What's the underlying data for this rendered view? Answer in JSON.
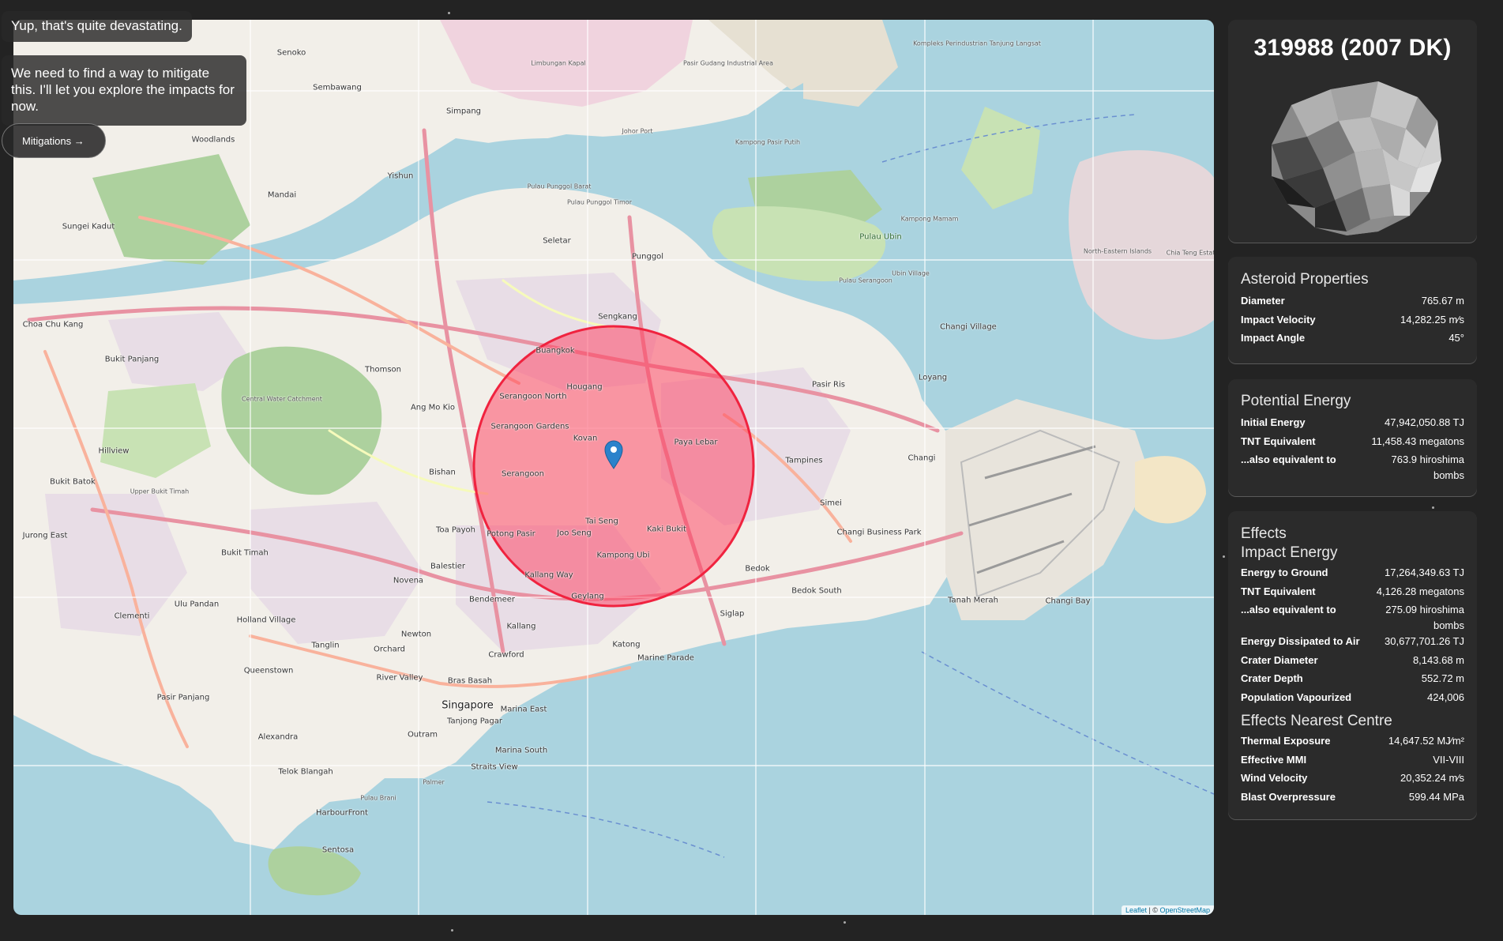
{
  "overlay": {
    "message1": "Yup, that's quite devastating.",
    "message2": "We need to find a way to mitigate this. I'll let you explore the impacts for now.",
    "mitigations_button": "Mitigations →"
  },
  "asteroid": {
    "name": "319988 (2007 DK)"
  },
  "properties": {
    "title": "Asteroid Properties",
    "rows": [
      {
        "label": "Diameter",
        "value": "765.67 m"
      },
      {
        "label": "Impact Velocity",
        "value": "14,282.25 m⁄s"
      },
      {
        "label": "Impact Angle",
        "value": "45°"
      }
    ]
  },
  "energy": {
    "title": "Potential Energy",
    "rows": [
      {
        "label": "Initial Energy",
        "value": "47,942,050.88 TJ"
      },
      {
        "label": "TNT Equivalent",
        "value": "11,458.43 megatons"
      },
      {
        "label": "...also equivalent to",
        "value": "763.9 hiroshima bombs"
      }
    ]
  },
  "effects": {
    "title": "Effects",
    "impact_title": "Impact Energy",
    "impact_rows": [
      {
        "label": "Energy to Ground",
        "value": "17,264,349.63 TJ"
      },
      {
        "label": "TNT Equivalent",
        "value": "4,126.28 megatons"
      },
      {
        "label": "...also equivalent to",
        "value": "275.09 hiroshima bombs"
      },
      {
        "label": "Energy Dissipated to Air",
        "value": "30,677,701.26 TJ"
      },
      {
        "label": "Crater Diameter",
        "value": "8,143.68 m"
      },
      {
        "label": "Crater Depth",
        "value": "552.72 m"
      },
      {
        "label": "Population Vapourized",
        "value": "424,006"
      }
    ],
    "nearest_title": "Effects Nearest Centre",
    "nearest_rows": [
      {
        "label": "Thermal Exposure",
        "value": "14,647.52 MJ⁄m²"
      },
      {
        "label": "Effective MMI",
        "value": "VII-VIII"
      },
      {
        "label": "Wind Velocity",
        "value": "20,352.24 m⁄s"
      },
      {
        "label": "Blast Overpressure",
        "value": "599.44 MPa"
      }
    ]
  },
  "map": {
    "attribution_leaflet": "Leaflet",
    "attribution_sep": " | © ",
    "attribution_osm": "OpenStreetMap",
    "impact_color": "#ff3b5c",
    "labels": [
      "Senoko",
      "Sembawang",
      "Simpang",
      "Yishun",
      "Woodlands",
      "Mandai",
      "Sungei Kadut",
      "Choa Chu Kang",
      "Bukit Panjang",
      "Thomson",
      "Central Water Catchment",
      "Hillview",
      "Bukit Batok",
      "Upper Bukit Timah",
      "Jurong East",
      "Bukit Timah",
      "Ulu Pandan",
      "Clementi",
      "Holland Village",
      "Queenstown",
      "Pasir Panjang",
      "Alexandra",
      "Telok Blangah",
      "HarbourFront",
      "Sentosa",
      "Novena",
      "Newton",
      "Tanglin",
      "Orchard",
      "River Valley",
      "Bras Basah",
      "Singapore",
      "Outram",
      "Tanjong Pagar",
      "Marina East",
      "Marina South",
      "Straits View",
      "Kallang",
      "Crawford",
      "Bendemeer",
      "Balestier",
      "Toa Payoh",
      "Bishan",
      "Ang Mo Kio",
      "Serangoon North",
      "Serangoon Gardens",
      "Serangoon",
      "Hougang",
      "Buangkok",
      "Kovan",
      "Paya Lebar",
      "Tai Seng",
      "Joo Seng",
      "Kaki Bukit",
      "Kampong Ubi",
      "Potong Pasir",
      "Kallang Way",
      "Geylang",
      "Katong",
      "Marine Parade",
      "Siglap",
      "Bedok",
      "Bedok South",
      "Tampines",
      "Simei",
      "Changi Business Park",
      "Tanah Merah",
      "Changi Bay",
      "Changi",
      "Loyang",
      "Pasir Ris",
      "Changi Village",
      "Sengkang",
      "Punggol",
      "Seletar",
      "Pulau Punggol Barat",
      "Pulau Punggol Timor",
      "Pulau Ubin",
      "Kampong Mamam",
      "Ubin Village",
      "North-Eastern Islands",
      "Chia Teng Estate",
      "Kampong Pasir Putih",
      "Pasir Gudang Industrial Area",
      "Kompleks Perindustrian Tanjung Langsat",
      "Johor Port",
      "Limbungan Kapal",
      "Pulau Brani",
      "Palmer",
      "Pulau Serangoon"
    ]
  }
}
